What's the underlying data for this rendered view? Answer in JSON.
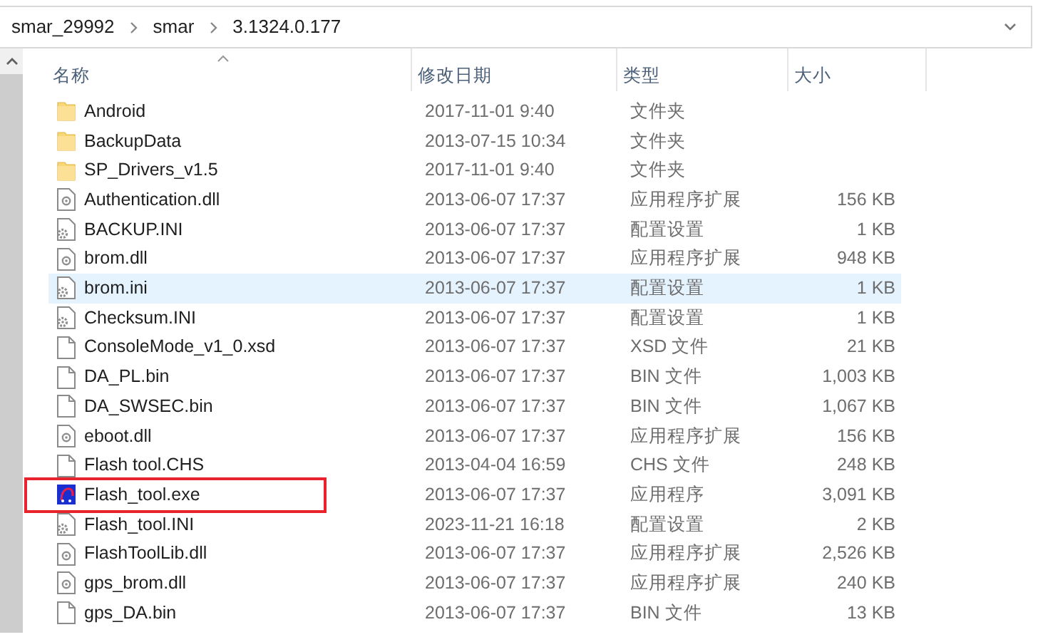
{
  "breadcrumb": [
    "smar_29992",
    "smar",
    "3.1324.0.177"
  ],
  "columns": [
    {
      "label": "名称",
      "sorted": true
    },
    {
      "label": "修改日期",
      "sorted": false
    },
    {
      "label": "类型",
      "sorted": false
    },
    {
      "label": "大小",
      "sorted": false
    }
  ],
  "rows": [
    {
      "kind": "folder",
      "name": "Android",
      "date": "2017-11-01 9:40",
      "type": "文件夹",
      "hovered": false,
      "marked": false
    },
    {
      "kind": "folder",
      "name": "BackupData",
      "date": "2013-07-15 10:34",
      "type": "文件夹",
      "hovered": false,
      "marked": false
    },
    {
      "kind": "folder",
      "name": "SP_Drivers_v1.5",
      "date": "2017-11-01 9:40",
      "type": "文件夹",
      "hovered": false,
      "marked": false
    },
    {
      "kind": "dll",
      "name": "Authentication.dll",
      "date": "2013-06-07 17:37",
      "type": "应用程序扩展",
      "size": "156 KB",
      "hovered": false,
      "marked": false
    },
    {
      "kind": "ini",
      "name": "BACKUP.INI",
      "date": "2013-06-07 17:37",
      "type": "配置设置",
      "size": "1 KB",
      "hovered": false,
      "marked": false
    },
    {
      "kind": "dll",
      "name": "brom.dll",
      "date": "2013-06-07 17:37",
      "type": "应用程序扩展",
      "size": "948 KB",
      "hovered": false,
      "marked": false
    },
    {
      "kind": "ini",
      "name": "brom.ini",
      "date": "2013-06-07 17:37",
      "type": "配置设置",
      "size": "1 KB",
      "hovered": true,
      "marked": false
    },
    {
      "kind": "ini",
      "name": "Checksum.INI",
      "date": "2013-06-07 17:37",
      "type": "配置设置",
      "size": "1 KB",
      "hovered": false,
      "marked": false
    },
    {
      "kind": "file",
      "name": "ConsoleMode_v1_0.xsd",
      "date": "2013-06-07 17:37",
      "type": "XSD 文件",
      "size": "21 KB",
      "hovered": false,
      "marked": false
    },
    {
      "kind": "file",
      "name": "DA_PL.bin",
      "date": "2013-06-07 17:37",
      "type": "BIN 文件",
      "size": "1,003 KB",
      "hovered": false,
      "marked": false
    },
    {
      "kind": "file",
      "name": "DA_SWSEC.bin",
      "date": "2013-06-07 17:37",
      "type": "BIN 文件",
      "size": "1,067 KB",
      "hovered": false,
      "marked": false
    },
    {
      "kind": "dll",
      "name": "eboot.dll",
      "date": "2013-06-07 17:37",
      "type": "应用程序扩展",
      "size": "156 KB",
      "hovered": false,
      "marked": false
    },
    {
      "kind": "file",
      "name": "Flash tool.CHS",
      "date": "2013-04-04 16:59",
      "type": "CHS 文件",
      "size": "248 KB",
      "hovered": false,
      "marked": false
    },
    {
      "kind": "exe",
      "name": "Flash_tool.exe",
      "date": "2013-06-07 17:37",
      "type": "应用程序",
      "size": "3,091 KB",
      "hovered": false,
      "marked": true
    },
    {
      "kind": "ini",
      "name": "Flash_tool.INI",
      "date": "2023-11-21 16:18",
      "type": "配置设置",
      "size": "2 KB",
      "hovered": false,
      "marked": false
    },
    {
      "kind": "dll",
      "name": "FlashToolLib.dll",
      "date": "2013-06-07 17:37",
      "type": "应用程序扩展",
      "size": "2,526 KB",
      "hovered": false,
      "marked": false
    },
    {
      "kind": "dll",
      "name": "gps_brom.dll",
      "date": "2013-06-07 17:37",
      "type": "应用程序扩展",
      "size": "240 KB",
      "hovered": false,
      "marked": false
    },
    {
      "kind": "file",
      "name": "gps_DA.bin",
      "date": "2013-06-07 17:37",
      "type": "BIN 文件",
      "size": "13 KB",
      "hovered": false,
      "marked": false
    }
  ]
}
